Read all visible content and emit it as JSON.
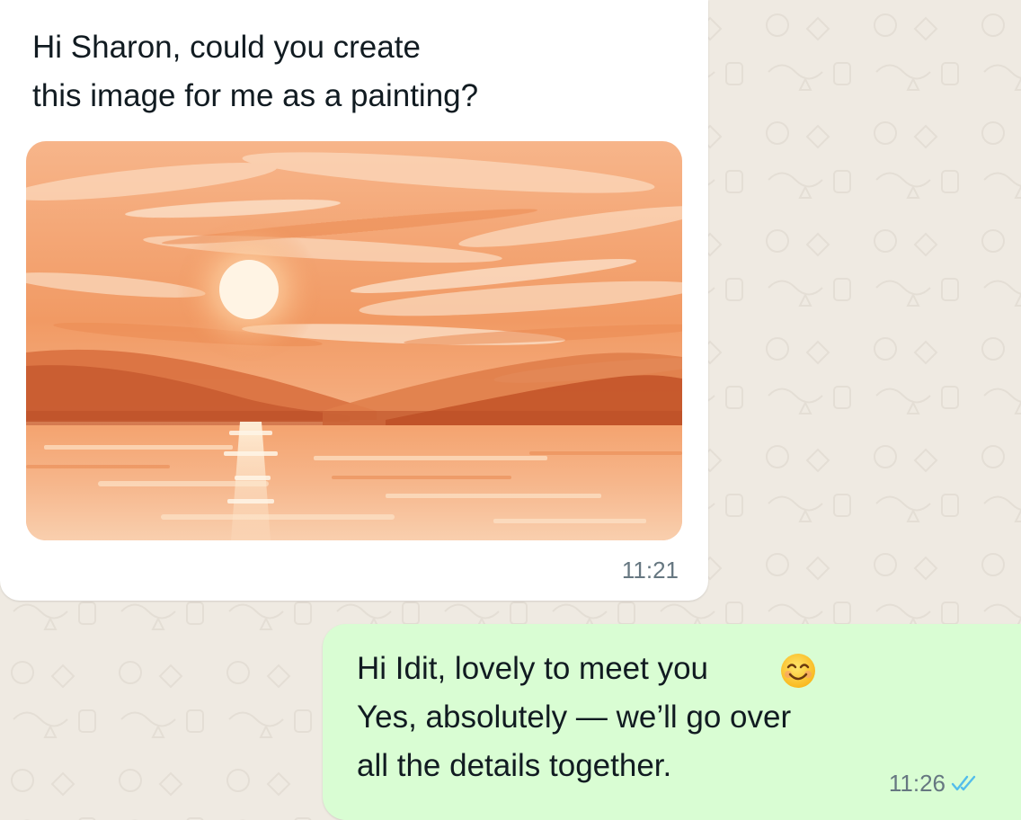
{
  "chat": {
    "incoming": {
      "text": "Hi Sharon, could you create\nthis image for me as a painting?",
      "time": "11:21",
      "image_subject": "sunset-lake-painting"
    },
    "outgoing": {
      "text": "Hi Idit, lovely to meet you\nYes, absolutely — we’ll go over\nall the details together.",
      "time": "11:26",
      "emoji": "smiling-face",
      "status": "read",
      "status_color": "#53bdeb"
    }
  },
  "colors": {
    "incoming_bubble": "#ffffff",
    "outgoing_bubble": "#d9fdd3",
    "wallpaper": "#efeae2",
    "text": "#111b21",
    "meta_text": "#667781"
  }
}
